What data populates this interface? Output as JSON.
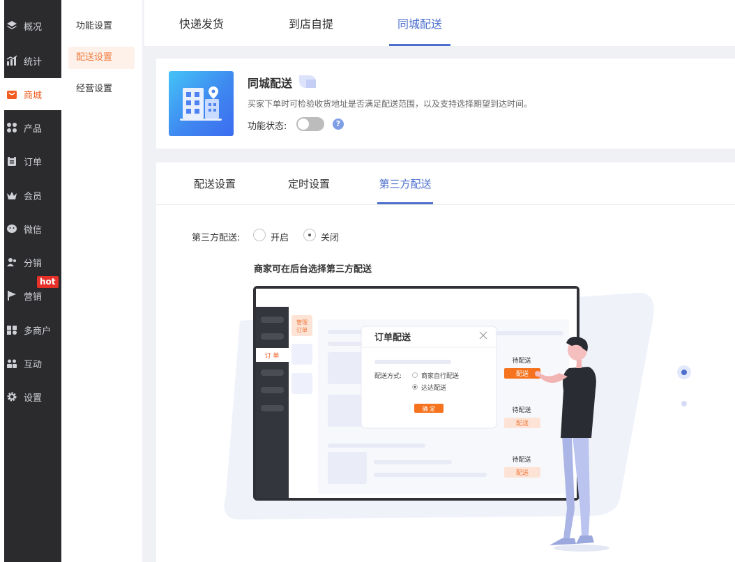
{
  "nav": {
    "items": [
      {
        "label": "概况",
        "icon": "layers-icon",
        "active": false
      },
      {
        "label": "统计",
        "icon": "chart-icon",
        "active": false
      },
      {
        "label": "商城",
        "icon": "store-icon",
        "active": true
      },
      {
        "label": "产品",
        "icon": "grid-icon",
        "active": false
      },
      {
        "label": "订单",
        "icon": "clipboard-icon",
        "active": false
      },
      {
        "label": "会员",
        "icon": "crown-icon",
        "active": false
      },
      {
        "label": "微信",
        "icon": "wechat-icon",
        "active": false
      },
      {
        "label": "分销",
        "icon": "users-icon",
        "active": false
      },
      {
        "label": "营销",
        "icon": "flag-icon",
        "active": false
      },
      {
        "label": "多商户",
        "icon": "shop-icon",
        "active": false
      },
      {
        "label": "互动",
        "icon": "people-icon",
        "active": false
      },
      {
        "label": "设置",
        "icon": "gear-icon",
        "active": false
      }
    ],
    "hot_badge": "hot"
  },
  "submenu": {
    "items": [
      {
        "label": "功能设置",
        "active": false
      },
      {
        "label": "配送设置",
        "active": true
      },
      {
        "label": "经营设置",
        "active": false
      }
    ]
  },
  "top_tabs": [
    {
      "label": "快递发货",
      "active": false
    },
    {
      "label": "到店自提",
      "active": false
    },
    {
      "label": "同城配送",
      "active": true
    }
  ],
  "feature": {
    "title": "同城配送",
    "description": "买家下单时可检验收货地址是否满足配送范围，以及支持选择期望到达时间。",
    "status_label": "功能状态:",
    "enabled": false,
    "help": "?"
  },
  "sub_tabs": [
    {
      "label": "配送设置",
      "active": false
    },
    {
      "label": "定时设置",
      "active": false
    },
    {
      "label": "第三方配送",
      "active": true
    }
  ],
  "third_party": {
    "label": "第三方配送:",
    "options": [
      {
        "label": "开启",
        "checked": false
      },
      {
        "label": "关闭",
        "checked": true
      }
    ],
    "illustration_title": "商家可在后台选择第三方配送"
  },
  "illustration": {
    "side_label": "订 单",
    "manage_order": [
      "管理",
      "订单"
    ],
    "dialog_title": "订单配送",
    "delivery_method_label": "配送方式:",
    "method_options": [
      "商家自行配送",
      "达达配送"
    ],
    "confirm": "确 定",
    "status": [
      "待配送",
      "待配送",
      "待配送"
    ],
    "action": [
      "配送",
      "配送",
      "配送"
    ]
  },
  "colors": {
    "accent": "#4c6fce",
    "brand_orange": "#f15c20",
    "nav_bg": "#2b2b2d"
  }
}
